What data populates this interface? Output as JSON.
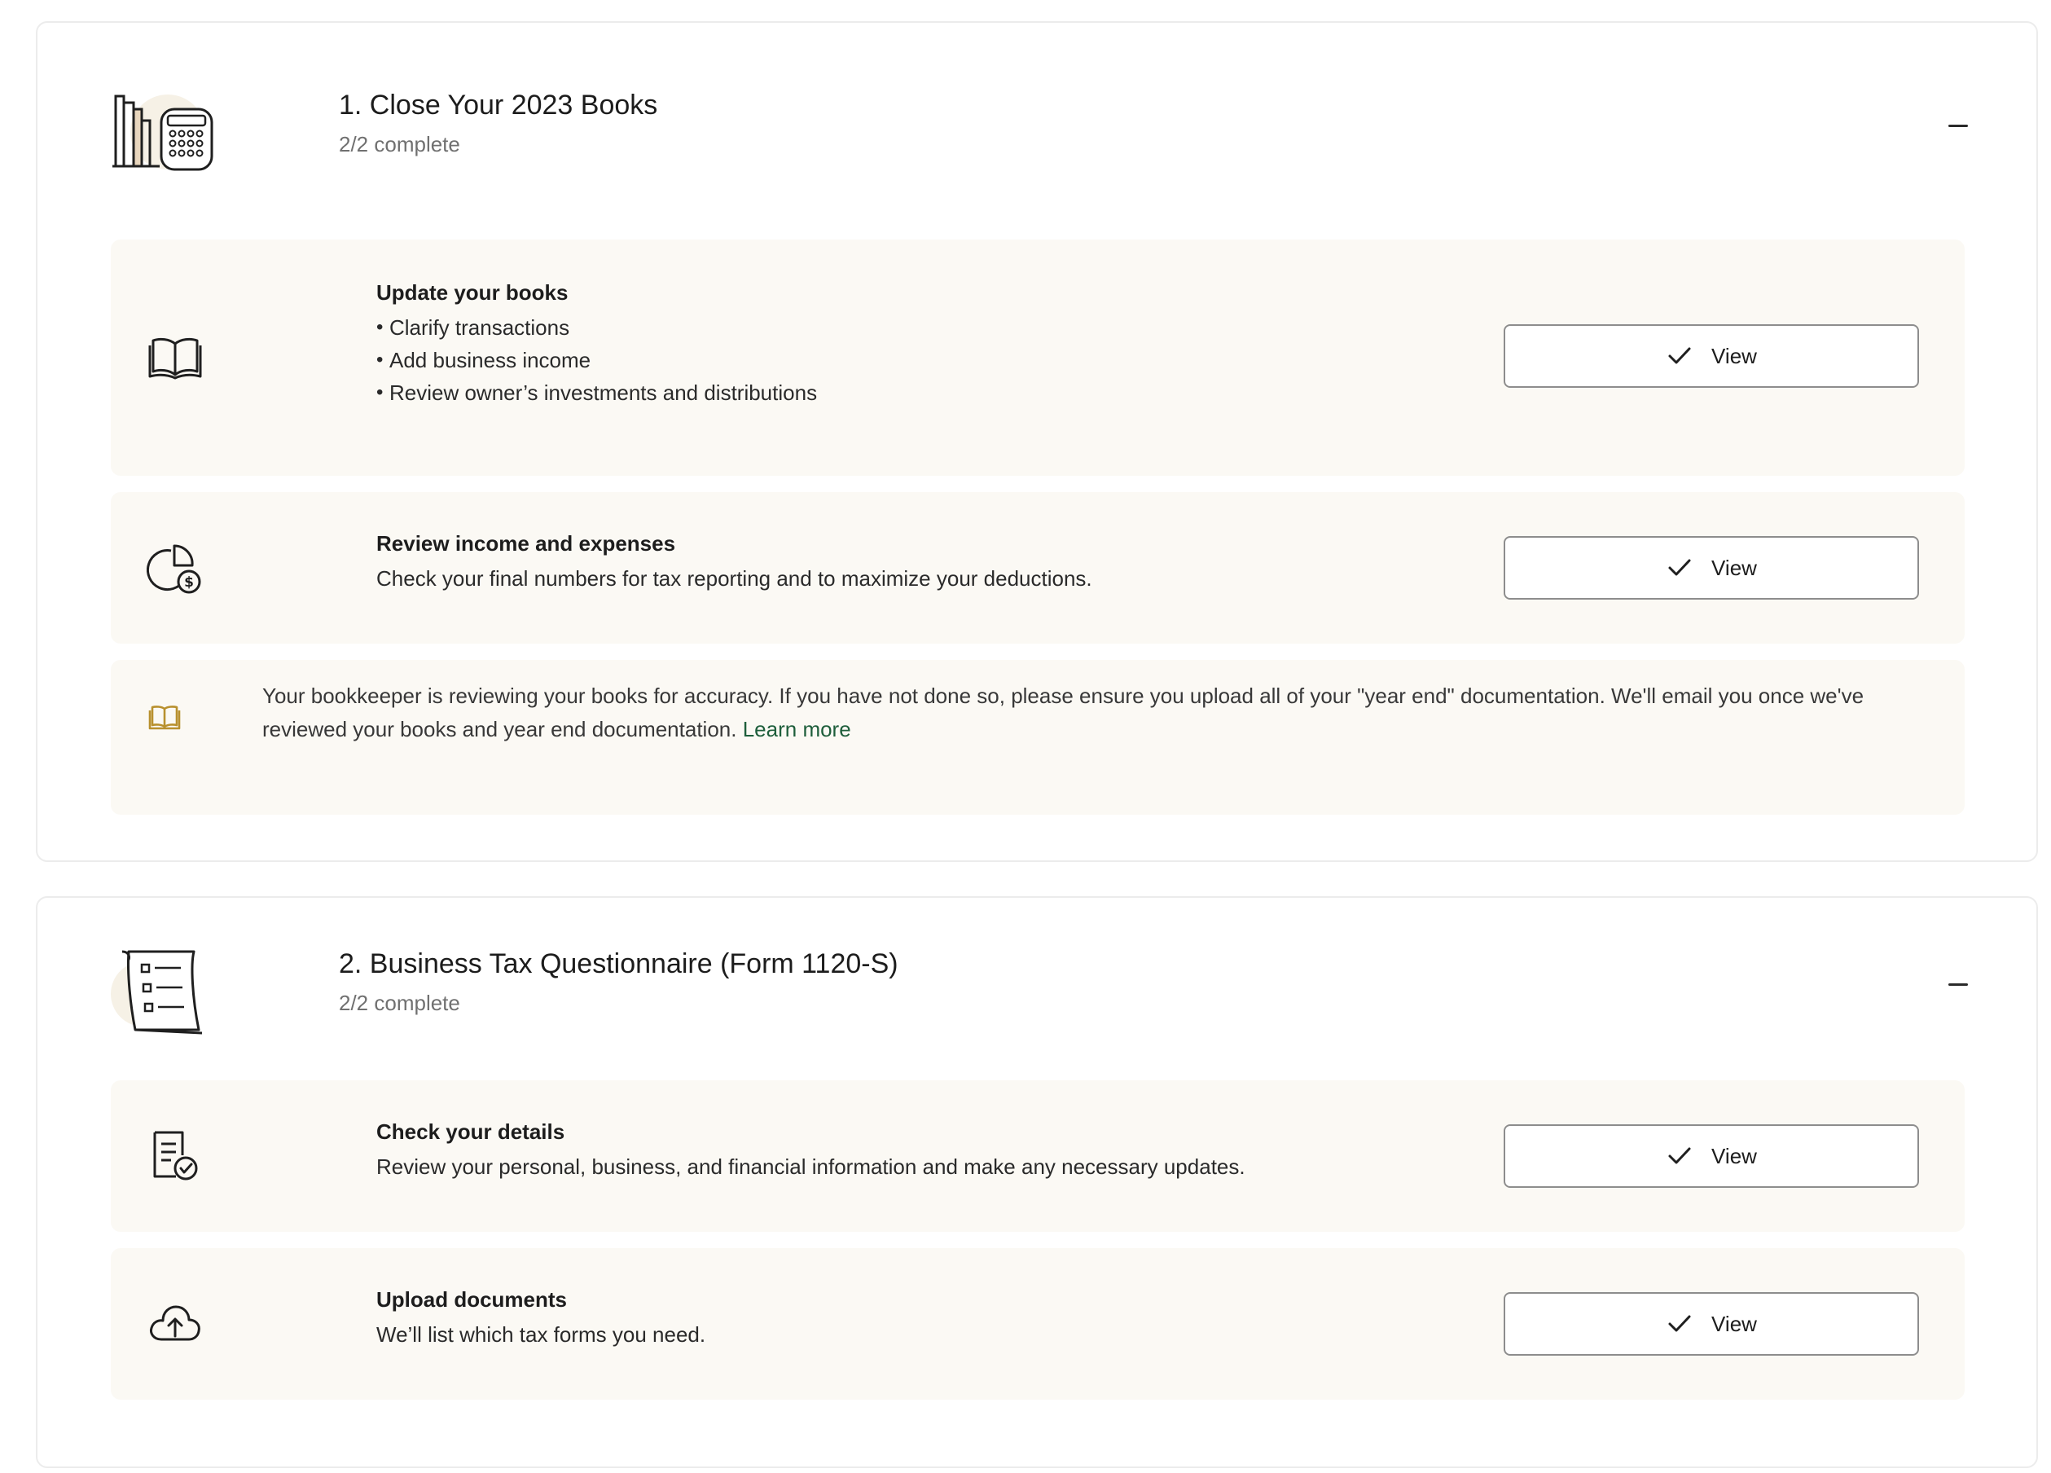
{
  "sections": [
    {
      "title": "1. Close Your 2023 Books",
      "progress": "2/2 complete",
      "illustration_icon": "books-calculator-icon",
      "items": [
        {
          "title": "Update your books",
          "bullets": [
            "Clarify transactions",
            "Add business income",
            "Review owner’s investments and distributions"
          ],
          "icon": "open-book-icon",
          "button_label": "View",
          "status": "complete"
        },
        {
          "title": "Review income and expenses",
          "description": "Check your final numbers for tax reporting and to maximize your deductions.",
          "icon": "pie-chart-dollar-icon",
          "button_label": "View",
          "status": "complete"
        }
      ],
      "notice": {
        "icon": "book-icon",
        "text": "Your bookkeeper is reviewing your books for accuracy. If you have not done so, please ensure you upload all of your \"year end\" documentation. We'll email you once we've reviewed your books and year end documentation.",
        "link_label": "Learn more"
      }
    },
    {
      "title": "2. Business Tax Questionnaire (Form 1120-S)",
      "progress": "2/2 complete",
      "illustration_icon": "checklist-scroll-icon",
      "items": [
        {
          "title": "Check your details",
          "description": "Review your personal, business, and financial information and make any necessary updates.",
          "icon": "document-check-icon",
          "button_label": "View",
          "status": "complete"
        },
        {
          "title": "Upload documents",
          "description": "We’ll list which tax forms you need.",
          "icon": "cloud-upload-icon",
          "button_label": "View",
          "status": "complete"
        }
      ]
    }
  ],
  "colors": {
    "card_background": "#fbf9f4",
    "link": "#1e5e3b",
    "notice_icon": "#b8902e",
    "border": "#ececec"
  }
}
